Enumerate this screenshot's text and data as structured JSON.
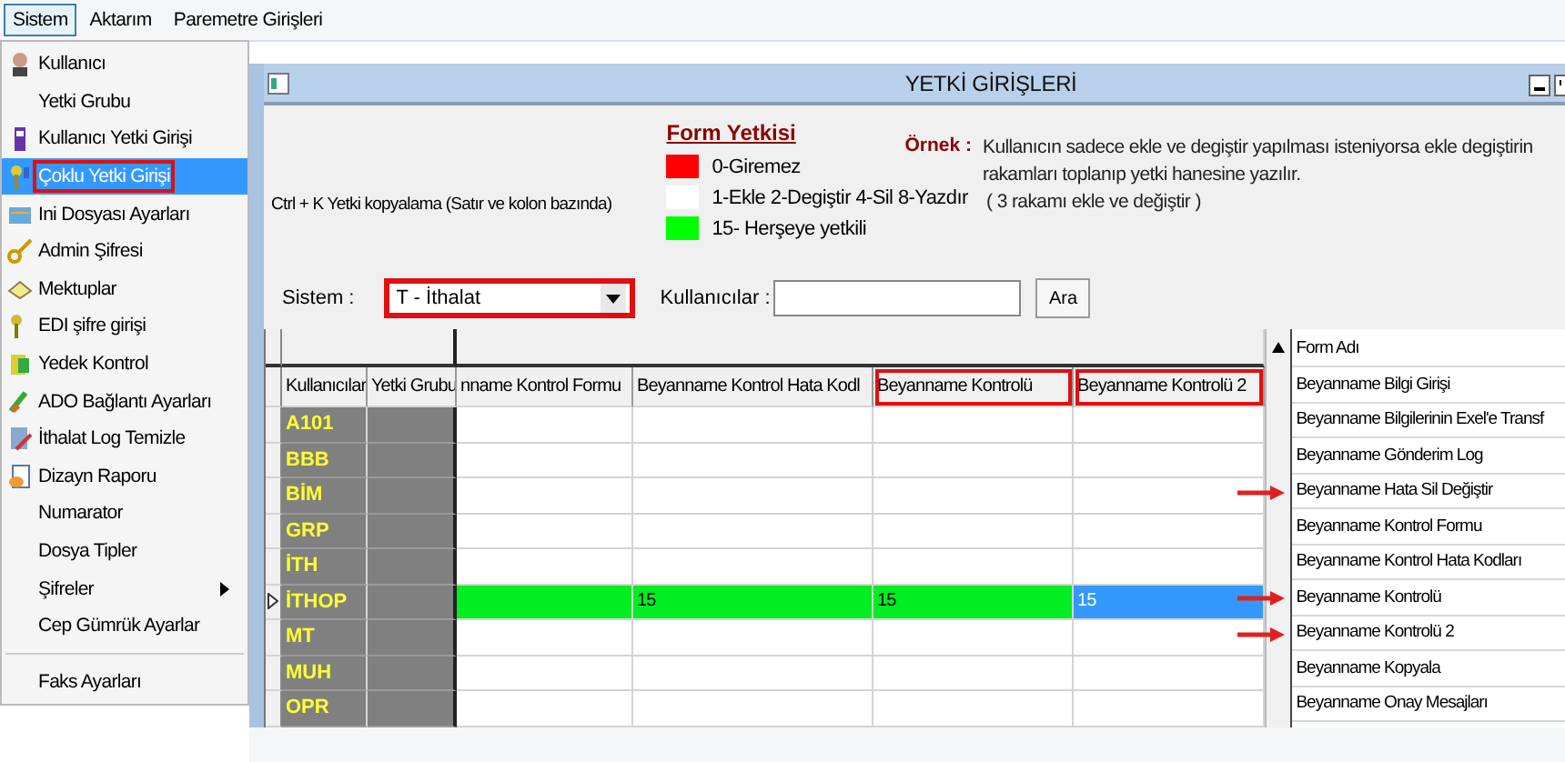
{
  "menubar": [
    {
      "label": "Sistem",
      "selected": true
    },
    {
      "label": "Aktarım",
      "selected": false
    },
    {
      "label": "Paremetre Girişleri",
      "selected": false
    }
  ],
  "menu": {
    "items": [
      {
        "kind": "item",
        "label": "Kullanıcı",
        "has_icon": true,
        "selected": false,
        "annotated": false,
        "submenu": false
      },
      {
        "kind": "item",
        "label": "Yetki Grubu",
        "has_icon": false,
        "selected": false,
        "annotated": false,
        "submenu": false
      },
      {
        "kind": "item",
        "label": "Kullanıcı Yetki Girişi",
        "has_icon": true,
        "selected": false,
        "annotated": false,
        "submenu": false
      },
      {
        "kind": "item",
        "label": "Çoklu Yetki Girişi",
        "has_icon": true,
        "selected": true,
        "annotated": true,
        "submenu": false
      },
      {
        "kind": "item",
        "label": "Ini Dosyası  Ayarları",
        "has_icon": true,
        "selected": false,
        "annotated": false,
        "submenu": false
      },
      {
        "kind": "item",
        "label": "Admin Şifresi",
        "has_icon": true,
        "selected": false,
        "annotated": false,
        "submenu": false
      },
      {
        "kind": "item",
        "label": "Mektuplar",
        "has_icon": true,
        "selected": false,
        "annotated": false,
        "submenu": false
      },
      {
        "kind": "item",
        "label": "EDI şifre girişi",
        "has_icon": true,
        "selected": false,
        "annotated": false,
        "submenu": false
      },
      {
        "kind": "item",
        "label": "Yedek Kontrol",
        "has_icon": true,
        "selected": false,
        "annotated": false,
        "submenu": false
      },
      {
        "kind": "item",
        "label": "ADO Bağlantı Ayarları",
        "has_icon": true,
        "selected": false,
        "annotated": false,
        "submenu": false
      },
      {
        "kind": "item",
        "label": "İthalat Log Temizle",
        "has_icon": true,
        "selected": false,
        "annotated": false,
        "submenu": false
      },
      {
        "kind": "item",
        "label": "Dizayn Raporu",
        "has_icon": true,
        "selected": false,
        "annotated": false,
        "submenu": false
      },
      {
        "kind": "item",
        "label": "Numarator",
        "has_icon": false,
        "selected": false,
        "annotated": false,
        "submenu": false
      },
      {
        "kind": "item",
        "label": "Dosya Tipler",
        "has_icon": false,
        "selected": false,
        "annotated": false,
        "submenu": false
      },
      {
        "kind": "item",
        "label": "Şifreler",
        "has_icon": false,
        "selected": false,
        "annotated": false,
        "submenu": true
      },
      {
        "kind": "item",
        "label": "Cep Gümrük Ayarlar",
        "has_icon": false,
        "selected": false,
        "annotated": false,
        "submenu": false
      },
      {
        "kind": "separator"
      },
      {
        "kind": "item",
        "label": "Faks Ayarları",
        "has_icon": false,
        "selected": false,
        "annotated": false,
        "submenu": false
      }
    ]
  },
  "window": {
    "title": "YETKİ GİRİŞLERİ",
    "hint": "Ctrl + K Yetki kopyalama (Satır ve kolon bazında)",
    "legend": {
      "title": "Form Yetkisi",
      "items": [
        {
          "label": "0-Giremez",
          "color": "#ff0000"
        },
        {
          "label": "1-Ekle  2-Degiştir  4-Sil  8-Yazdır",
          "color": "#ffffff"
        },
        {
          "label": "15- Herşeye yetkili",
          "color": "#00ff00"
        }
      ]
    },
    "example": {
      "label": "Örnek :",
      "text": "Kullanıcın sadece ekle ve degiştir yapılması isteniyorsa  ekle degiştirin rakamları toplanıp yetki hanesine yazılır.",
      "note": "( 3 rakamı ekle ve değiştir )"
    },
    "sistem": {
      "label": "Sistem :",
      "value": "T - İthalat",
      "annotated": true
    },
    "kullanicilar": {
      "label": "Kullanıcılar :"
    },
    "search_button": "Ara",
    "table": {
      "columns": [
        {
          "label": "Kullanıcılar",
          "annotated": false
        },
        {
          "label": "Yetki Grubu",
          "annotated": false
        },
        {
          "label": "nname Kontrol Formu",
          "annotated": false
        },
        {
          "label": "Beyanname Kontrol Hata Kodl",
          "annotated": false
        },
        {
          "label": "Beyanname Kontrolü",
          "annotated": true
        },
        {
          "label": "Beyanname Kontrolü 2",
          "annotated": true
        }
      ],
      "rows": [
        {
          "user": "A101",
          "current": false
        },
        {
          "user": "BBB",
          "current": false
        },
        {
          "user": "BİM",
          "current": false
        },
        {
          "user": "GRP",
          "current": false
        },
        {
          "user": "İTH",
          "current": false
        },
        {
          "user": "İTHOP",
          "current": true,
          "cells": [
            {
              "text": "",
              "kind": "full",
              "selected": false
            },
            {
              "text": "15",
              "kind": "full",
              "selected": false
            },
            {
              "text": "15",
              "kind": "full",
              "selected": false
            },
            {
              "text": "15",
              "kind": "full",
              "selected": true
            }
          ]
        },
        {
          "user": "MT",
          "current": false
        },
        {
          "user": "MUH",
          "current": false
        },
        {
          "user": "OPR",
          "current": false
        }
      ]
    },
    "forms": {
      "header": "Form Adı",
      "items": [
        {
          "label": "Beyanname Bilgi Girişi",
          "arrow": false
        },
        {
          "label": "Beyanname Bilgilerinin Exel'e Transf",
          "arrow": false
        },
        {
          "label": "Beyanname Gönderim Log",
          "arrow": false
        },
        {
          "label": "Beyanname Hata Sil Değiştir",
          "arrow": true
        },
        {
          "label": "Beyanname Kontrol Formu",
          "arrow": false
        },
        {
          "label": "Beyanname Kontrol Hata Kodları",
          "arrow": false
        },
        {
          "label": "Beyanname Kontrolü",
          "arrow": true
        },
        {
          "label": "Beyanname Kontrolü 2",
          "arrow": true
        },
        {
          "label": "Beyanname Kopyala",
          "arrow": false
        },
        {
          "label": "Beyanname Onay Mesajları",
          "arrow": false
        }
      ]
    }
  }
}
